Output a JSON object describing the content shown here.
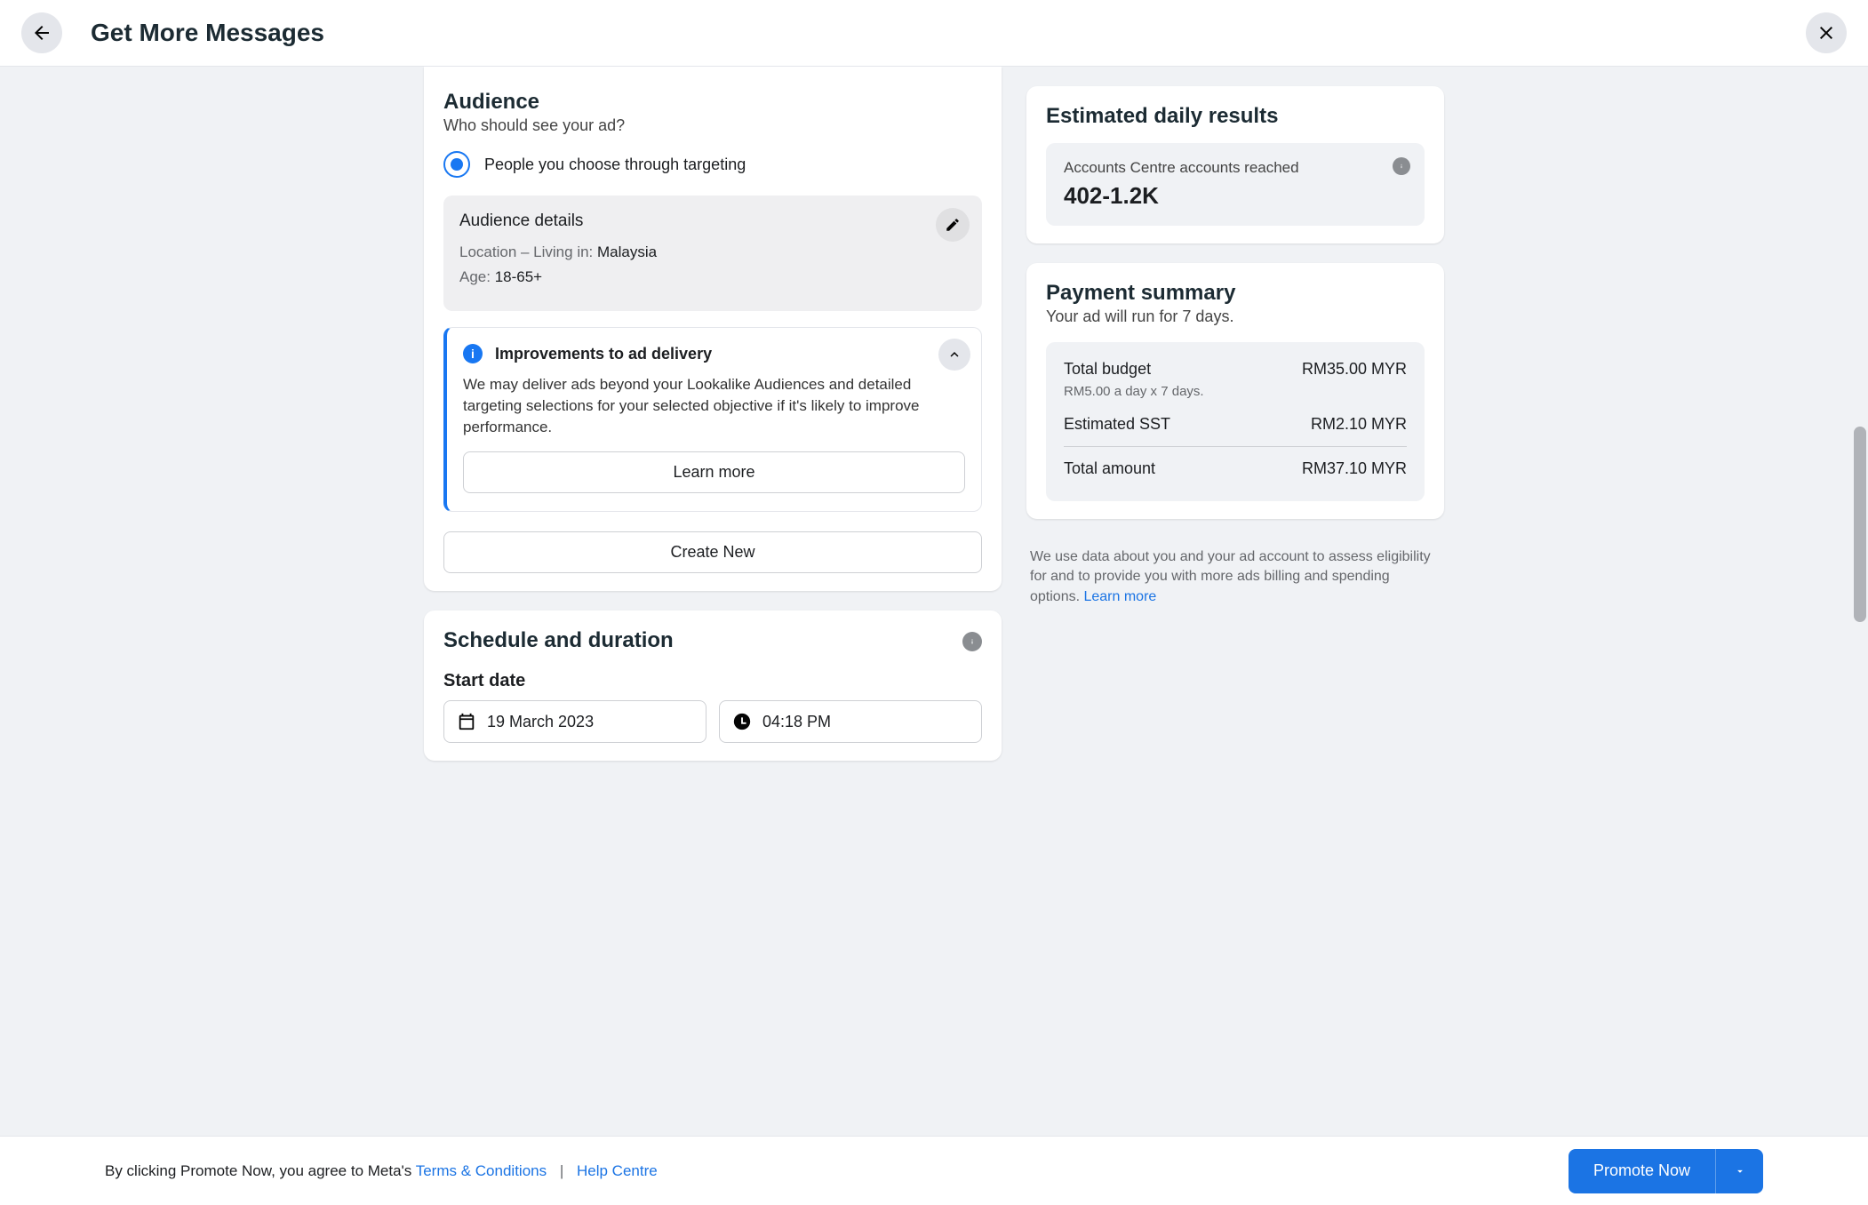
{
  "header": {
    "title": "Get More Messages"
  },
  "audience": {
    "title": "Audience",
    "subtitle": "Who should see your ad?",
    "radio_option": "People you choose through targeting",
    "details": {
      "title": "Audience details",
      "location_prefix": "Location – Living in: ",
      "location_value": "Malaysia",
      "age_prefix": "Age: ",
      "age_value": "18-65+"
    },
    "info": {
      "title": "Improvements to ad delivery",
      "body": "We may deliver ads beyond your Lookalike Audiences and detailed targeting selections for your selected objective if it's likely to improve performance.",
      "learn_more": "Learn more"
    },
    "create_new": "Create New"
  },
  "schedule": {
    "title": "Schedule and duration",
    "start_label": "Start date",
    "date": "19 March 2023",
    "time": "04:18 PM"
  },
  "estimated": {
    "title": "Estimated daily results",
    "metric_label": "Accounts Centre accounts reached",
    "metric_value": "402-1.2K"
  },
  "payment": {
    "title": "Payment summary",
    "subtitle": "Your ad will run for 7 days.",
    "budget_label": "Total budget",
    "budget_value": "RM35.00 MYR",
    "budget_sub": "RM5.00 a day x 7 days.",
    "sst_label": "Estimated SST",
    "sst_value": "RM2.10 MYR",
    "total_label": "Total amount",
    "total_value": "RM37.10 MYR"
  },
  "disclaimer": {
    "text": "We use data about you and your ad account to assess eligibility for and to provide you with more ads billing and spending options. ",
    "link": "Learn more"
  },
  "footer": {
    "text_prefix": "By clicking Promote Now, you agree to Meta's ",
    "terms": "Terms & Conditions",
    "sep": "|",
    "help": "Help Centre",
    "promote": "Promote Now"
  }
}
